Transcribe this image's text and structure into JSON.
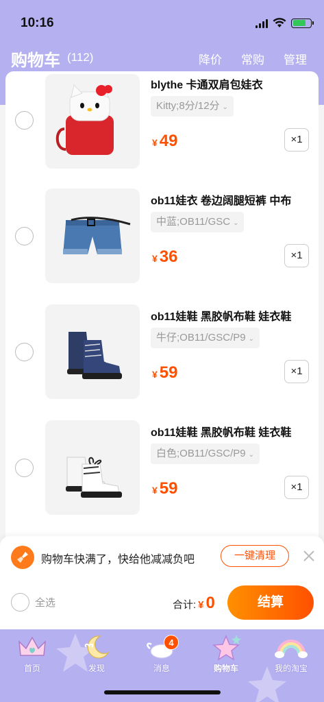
{
  "status": {
    "time": "10:16"
  },
  "header": {
    "title": "购物车",
    "count": "(112)",
    "actions": [
      "降价",
      "常购",
      "管理"
    ]
  },
  "items": [
    {
      "title": "blythe 卡通双肩包娃衣",
      "sku": "Kitty;8分/12分",
      "currency": "¥",
      "price": "49",
      "qty": "×1",
      "image": "hello-kitty-backpack"
    },
    {
      "title": "ob11娃衣 卷边阔腿短裤 中布",
      "sku": "中蓝;OB11/GSC",
      "currency": "¥",
      "price": "36",
      "qty": "×1",
      "image": "denim-shorts"
    },
    {
      "title": "ob11娃鞋 黑胶帆布鞋 娃衣鞋",
      "sku": "牛仔;OB11/GSC/P9",
      "currency": "¥",
      "price": "59",
      "qty": "×1",
      "image": "denim-canvas-shoes"
    },
    {
      "title": "ob11娃鞋 黑胶帆布鞋 娃衣鞋",
      "sku": "白色;OB11/GSC/P9",
      "currency": "¥",
      "price": "59",
      "qty": "×1",
      "image": "white-canvas-shoes"
    }
  ],
  "bottom": {
    "tip": "购物车快满了，快给他减减负吧",
    "clean_label": "一键清理",
    "select_all": "全选",
    "total_label": "合计:",
    "total_currency": "¥",
    "total_amount": "0",
    "checkout_label": "结算"
  },
  "tabs": [
    {
      "label": "首页",
      "icon": "crown-icon"
    },
    {
      "label": "发现",
      "icon": "moon-icon"
    },
    {
      "label": "消息",
      "icon": "cloud-wings-icon",
      "badge": "4"
    },
    {
      "label": "购物车",
      "icon": "star-icon"
    },
    {
      "label": "我的淘宝",
      "icon": "rainbow-icon"
    }
  ],
  "colors": {
    "header_bg": "#b5b0f0",
    "accent": "#ff5000",
    "checkout_start": "#ff9000"
  }
}
